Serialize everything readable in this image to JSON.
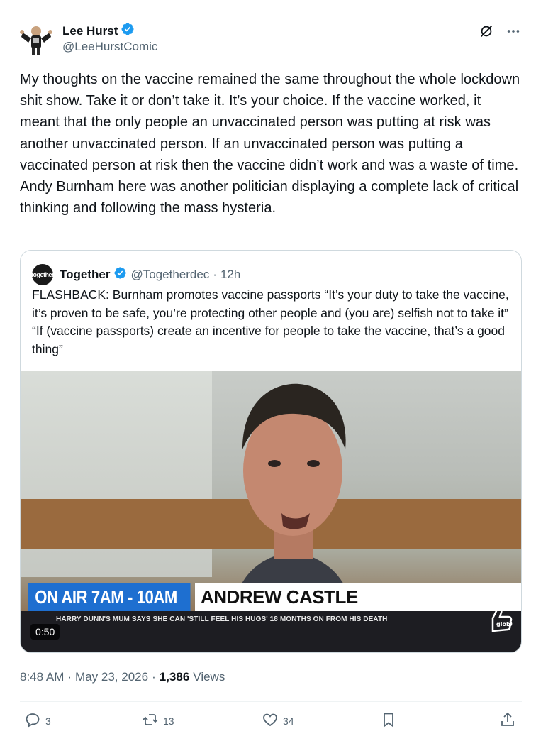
{
  "author": {
    "name": "Lee Hurst",
    "handle": "@LeeHurstComic"
  },
  "header_icons": [
    "grok-icon",
    "more-icon"
  ],
  "tweet": {
    "text": "My thoughts on the vaccine remained the same throughout the whole lockdown shit show. Take it or don’t take it. It’s your choice. If the vaccine worked, it meant that the only people an unvaccinated person was putting at risk was another unvaccinated person. If an unvaccinated person was putting a vaccinated person at risk then the vaccine didn’t work and was a waste of time. Andy Burnham here was another politician displaying a complete lack of critical thinking and following the mass hysteria."
  },
  "quote": {
    "avatar_text": "together",
    "name": "Together",
    "handle": "@Togetherdec",
    "dot": "·",
    "time": "12h",
    "text": "FLASHBACK: Burnham promotes vaccine passports “It’s your duty to take the vaccine, it’s proven to be safe, you’re protecting other people and (you are) selfish not to take it” “If (vaccine passports) create an incentive for people to take the vaccine, that’s a good thing”",
    "video": {
      "onair_label": "ON AIR 7AM - 10AM",
      "presenter": "ANDREW CASTLE",
      "ticker": "HARRY DUNN'S MUM SAYS SHE CAN 'STILL FEEL HIS HUGS' 18 MONTHS ON FROM HIS DEATH",
      "duration": "0:50",
      "logo_text": "glob"
    }
  },
  "meta": {
    "time": "8:48 AM",
    "sep1": "·",
    "date": "May 23, 2026",
    "sep2": "·",
    "views_count": "1,386",
    "views_label": "Views"
  },
  "actions": {
    "replies": "3",
    "reposts": "13",
    "likes": "34"
  },
  "colors": {
    "verified": "#1d9bf0",
    "text": "#0f1419",
    "secondary": "#536471",
    "border": "#cfd9de",
    "onair_blue": "#1e6fd0"
  }
}
